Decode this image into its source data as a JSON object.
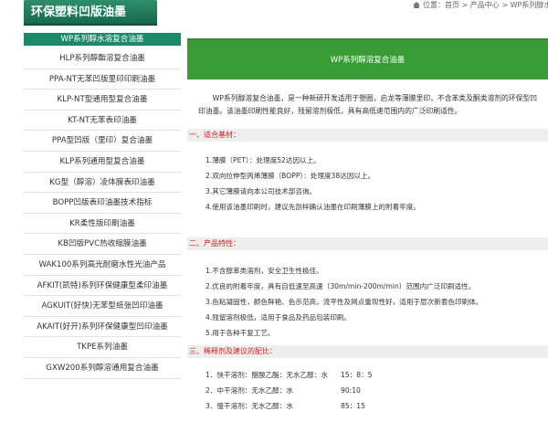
{
  "sidebar": {
    "title": "环保塑料凹版油墨",
    "items": [
      "WP系列醇水溶复合油墨",
      "HLP系列醇酯溶复合油墨",
      "PPA-NT无苯凹版里印印刷油墨",
      "KLP-NT型通用型复合油墨",
      "KT-NT无苯表印油墨",
      "PPA型凹版（里印）复合油墨",
      "KLP系列通用型复合油墨",
      "KG型（醇溶）凌体膜表印油墨",
      "BOPP凹版表印油墨技术指标",
      "KR柔性版印刷油墨",
      "KB凹版PVC热收缩膜油墨",
      "WAK100系列高光耐磨水性光油产品",
      "AFKIT(凯特)系列环保健康型柔印油墨",
      "AGKUIT(好快)无苯型纸张凹印油墨",
      "AKAIT(好开)系列环保健康型凹印油墨",
      "TKPE系列油墨",
      "GXW200系列醇溶通用复合油墨"
    ]
  },
  "breadcrumb": {
    "text": "位置：首页 > 产品中心 > WP系列醇水"
  },
  "main": {
    "banner": "WP系列醇溶复合油墨",
    "intro": "WP系列醇溶复合油墨，是一种新研开发适用于塑圈，启龙等薄膜里印，不含苯类及酮类溶剂的环保型凹印油墨。该油墨印刷性能良好，残留溶剂极低，具有高低速范围内的广泛印刷适性。",
    "sections": [
      {
        "head": "一、适合基材：",
        "lines": [
          "1.薄膜（PET）：处理度52达因以上。",
          "2.双向拉伸型丙烯薄膜（BOPP）：处理度38达因以上。",
          "3.其它薄膜请向本公司技术部咨询。",
          "4.使用该油墨印刷时，建议先剖样确认油墨在印刷薄膜上的附着牢度。"
        ]
      },
      {
        "head": "二、产品特性：",
        "lines": [
          "1.不含醇苯类溶剂，安全卫生性极佳。",
          "2.优良的附着牢度，具有自低速至高速（30m/min-200m/min）范围内广泛印刷适性。",
          "3.色粘凝固性，颜色鲜艳、色示范高，流平性及网点重现性好，适用于层次新套色印刷体。",
          "4.残留溶剂极低，适用于食品及药品包装印刷。",
          "5.用于各种干复工艺。"
        ]
      },
      {
        "head": "三、稀释剂及建议的配比：",
        "rows": [
          {
            "label": "1．快干溶剂：醋酸乙酯：无水乙醇：水",
            "ratio": "15：8：5"
          },
          {
            "label": "2．中干溶剂：无水乙醇：水",
            "ratio": "90:10"
          },
          {
            "label": "3．慢干溶剂：无水乙醇：水",
            "ratio": "85：15"
          }
        ]
      }
    ]
  },
  "colors": {
    "sidebar_title_bg": "#1a7552",
    "sidebar_active_bg": "#1c8a68",
    "banner_bg": "#389d35",
    "section_head_text": "#d02020",
    "section_head_bg": "#eeeeee"
  }
}
